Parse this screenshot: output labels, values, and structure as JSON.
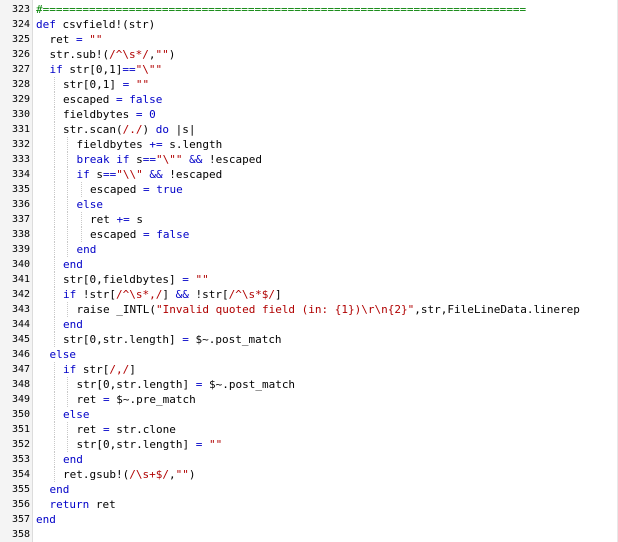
{
  "editor": {
    "lines": [
      {
        "n": "323",
        "indent": 0,
        "segs": [
          {
            "t": "#=========================================================================",
            "c": "cmt"
          }
        ]
      },
      {
        "n": "324",
        "indent": 0,
        "segs": [
          {
            "t": "def",
            "c": "kw"
          },
          {
            "t": " csvfield!(str)"
          }
        ]
      },
      {
        "n": "325",
        "indent": 1,
        "segs": [
          {
            "t": "ret "
          },
          {
            "t": "=",
            "c": "op"
          },
          {
            "t": " "
          },
          {
            "t": "\"\"",
            "c": "str"
          }
        ]
      },
      {
        "n": "326",
        "indent": 1,
        "segs": [
          {
            "t": "str.sub!("
          },
          {
            "t": "/^\\s*/",
            "c": "str"
          },
          {
            "t": ","
          },
          {
            "t": "\"\"",
            "c": "str"
          },
          {
            "t": ")"
          }
        ]
      },
      {
        "n": "327",
        "indent": 1,
        "segs": [
          {
            "t": "if",
            "c": "kw"
          },
          {
            "t": " str[0,1]"
          },
          {
            "t": "==",
            "c": "op"
          },
          {
            "t": "\"\\\"\"",
            "c": "str"
          }
        ]
      },
      {
        "n": "328",
        "indent": 2,
        "segs": [
          {
            "t": "str[0,1] "
          },
          {
            "t": "=",
            "c": "op"
          },
          {
            "t": " "
          },
          {
            "t": "\"\"",
            "c": "str"
          }
        ]
      },
      {
        "n": "329",
        "indent": 2,
        "segs": [
          {
            "t": "escaped "
          },
          {
            "t": "=",
            "c": "op"
          },
          {
            "t": " "
          },
          {
            "t": "false",
            "c": "kw"
          }
        ]
      },
      {
        "n": "330",
        "indent": 2,
        "segs": [
          {
            "t": "fieldbytes "
          },
          {
            "t": "=",
            "c": "op"
          },
          {
            "t": " "
          },
          {
            "t": "0",
            "c": "num"
          }
        ]
      },
      {
        "n": "331",
        "indent": 2,
        "segs": [
          {
            "t": "str.scan("
          },
          {
            "t": "/./",
            "c": "str"
          },
          {
            "t": ") "
          },
          {
            "t": "do",
            "c": "kw"
          },
          {
            "t": " |s|"
          }
        ]
      },
      {
        "n": "332",
        "indent": 3,
        "segs": [
          {
            "t": "fieldbytes "
          },
          {
            "t": "+=",
            "c": "op"
          },
          {
            "t": " s.length"
          }
        ]
      },
      {
        "n": "333",
        "indent": 3,
        "segs": [
          {
            "t": "break",
            "c": "kw"
          },
          {
            "t": " "
          },
          {
            "t": "if",
            "c": "kw"
          },
          {
            "t": " s"
          },
          {
            "t": "==",
            "c": "op"
          },
          {
            "t": "\"\\\"\"",
            "c": "str"
          },
          {
            "t": " "
          },
          {
            "t": "&&",
            "c": "op"
          },
          {
            "t": " !escaped"
          }
        ]
      },
      {
        "n": "334",
        "indent": 3,
        "segs": [
          {
            "t": "if",
            "c": "kw"
          },
          {
            "t": " s"
          },
          {
            "t": "==",
            "c": "op"
          },
          {
            "t": "\"\\\\\"",
            "c": "str"
          },
          {
            "t": " "
          },
          {
            "t": "&&",
            "c": "op"
          },
          {
            "t": " !escaped"
          }
        ]
      },
      {
        "n": "335",
        "indent": 4,
        "segs": [
          {
            "t": "escaped "
          },
          {
            "t": "=",
            "c": "op"
          },
          {
            "t": " "
          },
          {
            "t": "true",
            "c": "kw"
          }
        ]
      },
      {
        "n": "336",
        "indent": 3,
        "segs": [
          {
            "t": "else",
            "c": "kw"
          }
        ]
      },
      {
        "n": "337",
        "indent": 4,
        "segs": [
          {
            "t": "ret "
          },
          {
            "t": "+=",
            "c": "op"
          },
          {
            "t": " s"
          }
        ]
      },
      {
        "n": "338",
        "indent": 4,
        "segs": [
          {
            "t": "escaped "
          },
          {
            "t": "=",
            "c": "op"
          },
          {
            "t": " "
          },
          {
            "t": "false",
            "c": "kw"
          }
        ]
      },
      {
        "n": "339",
        "indent": 3,
        "segs": [
          {
            "t": "end",
            "c": "kw"
          }
        ]
      },
      {
        "n": "340",
        "indent": 2,
        "segs": [
          {
            "t": "end",
            "c": "kw"
          }
        ]
      },
      {
        "n": "341",
        "indent": 2,
        "segs": [
          {
            "t": "str[0,fieldbytes] "
          },
          {
            "t": "=",
            "c": "op"
          },
          {
            "t": " "
          },
          {
            "t": "\"\"",
            "c": "str"
          }
        ]
      },
      {
        "n": "342",
        "indent": 2,
        "segs": [
          {
            "t": "if",
            "c": "kw"
          },
          {
            "t": " !str["
          },
          {
            "t": "/^\\s*,/",
            "c": "str"
          },
          {
            "t": "] "
          },
          {
            "t": "&&",
            "c": "op"
          },
          {
            "t": " !str["
          },
          {
            "t": "/^\\s*$/",
            "c": "str"
          },
          {
            "t": "]"
          }
        ]
      },
      {
        "n": "343",
        "indent": 3,
        "segs": [
          {
            "t": "raise _INTL("
          },
          {
            "t": "\"Invalid quoted field (in: {1})\\r\\n{2}\"",
            "c": "str"
          },
          {
            "t": ",str,FileLineData.linerep"
          }
        ]
      },
      {
        "n": "344",
        "indent": 2,
        "segs": [
          {
            "t": "end",
            "c": "kw"
          }
        ]
      },
      {
        "n": "345",
        "indent": 2,
        "segs": [
          {
            "t": "str[0,str.length] "
          },
          {
            "t": "=",
            "c": "op"
          },
          {
            "t": " $~.post_match"
          }
        ]
      },
      {
        "n": "346",
        "indent": 1,
        "segs": [
          {
            "t": "else",
            "c": "kw"
          }
        ]
      },
      {
        "n": "347",
        "indent": 2,
        "segs": [
          {
            "t": "if",
            "c": "kw"
          },
          {
            "t": " str["
          },
          {
            "t": "/,/",
            "c": "str"
          },
          {
            "t": "]"
          }
        ]
      },
      {
        "n": "348",
        "indent": 3,
        "segs": [
          {
            "t": "str[0,str.length] "
          },
          {
            "t": "=",
            "c": "op"
          },
          {
            "t": " $~.post_match"
          }
        ]
      },
      {
        "n": "349",
        "indent": 3,
        "segs": [
          {
            "t": "ret "
          },
          {
            "t": "=",
            "c": "op"
          },
          {
            "t": " $~.pre_match"
          }
        ]
      },
      {
        "n": "350",
        "indent": 2,
        "segs": [
          {
            "t": "else",
            "c": "kw"
          }
        ]
      },
      {
        "n": "351",
        "indent": 3,
        "segs": [
          {
            "t": "ret "
          },
          {
            "t": "=",
            "c": "op"
          },
          {
            "t": " str.clone"
          }
        ]
      },
      {
        "n": "352",
        "indent": 3,
        "segs": [
          {
            "t": "str[0,str.length] "
          },
          {
            "t": "=",
            "c": "op"
          },
          {
            "t": " "
          },
          {
            "t": "\"\"",
            "c": "str"
          }
        ]
      },
      {
        "n": "353",
        "indent": 2,
        "segs": [
          {
            "t": "end",
            "c": "kw"
          }
        ]
      },
      {
        "n": "354",
        "indent": 2,
        "segs": [
          {
            "t": "ret.gsub!("
          },
          {
            "t": "/\\s+$/",
            "c": "str"
          },
          {
            "t": ","
          },
          {
            "t": "\"\"",
            "c": "str"
          },
          {
            "t": ")"
          }
        ]
      },
      {
        "n": "355",
        "indent": 1,
        "segs": [
          {
            "t": "end",
            "c": "kw"
          }
        ]
      },
      {
        "n": "356",
        "indent": 1,
        "segs": [
          {
            "t": "return",
            "c": "kw"
          },
          {
            "t": " ret"
          }
        ]
      },
      {
        "n": "357",
        "indent": 0,
        "segs": [
          {
            "t": "end",
            "c": "kw"
          }
        ]
      },
      {
        "n": "358",
        "indent": 0,
        "segs": []
      }
    ]
  }
}
